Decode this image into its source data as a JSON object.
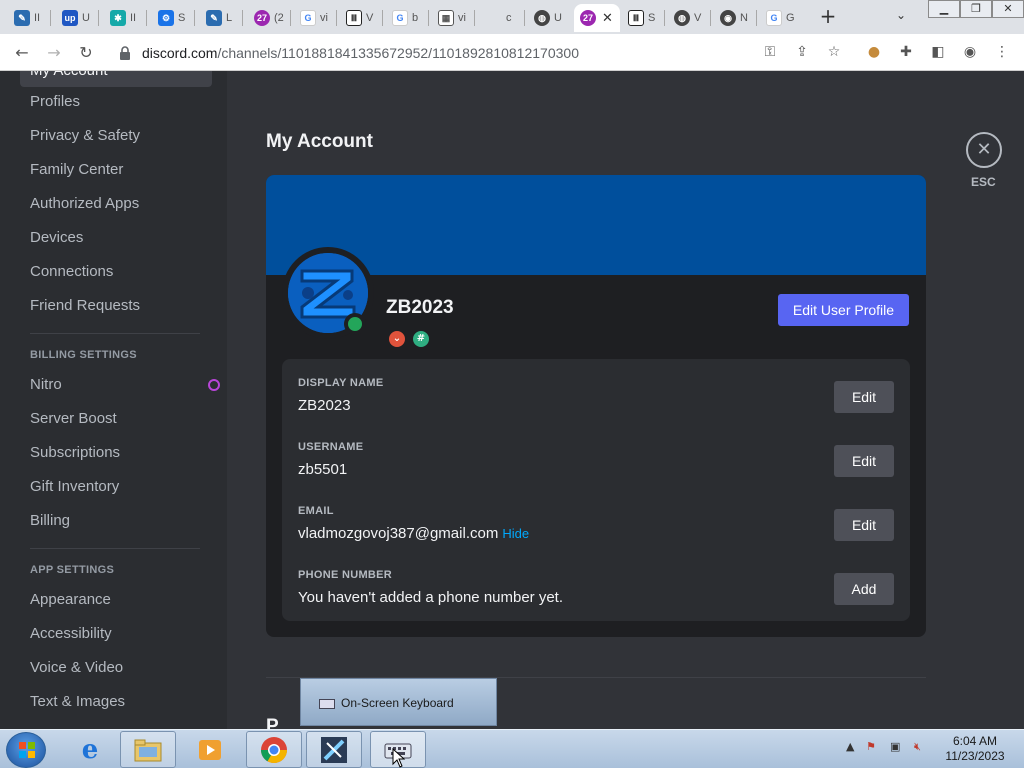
{
  "browser": {
    "tabs": [
      {
        "title": "II",
        "icon": "feather-icon",
        "color": "#2b6cb0"
      },
      {
        "title": "U",
        "icon": "upwork-icon",
        "color": "#1f57c3"
      },
      {
        "title": "II",
        "icon": "snowflake-icon",
        "color": "#15a9a9"
      },
      {
        "title": "S",
        "icon": "gear-icon",
        "color": "#1a73e8"
      },
      {
        "title": "L",
        "icon": "feather-icon",
        "color": "#2b6cb0"
      },
      {
        "title": "(2",
        "icon": "counter-badge-icon",
        "color": "#9c27b0"
      },
      {
        "title": "vi",
        "icon": "google-icon",
        "color": "#4285f4"
      },
      {
        "title": "V",
        "icon": "museum-icon",
        "color": "#222222"
      },
      {
        "title": "b",
        "icon": "google-icon",
        "color": "#4285f4"
      },
      {
        "title": "vi",
        "icon": "qr-icon",
        "color": "#555555"
      },
      {
        "title": "c",
        "icon": "blank-icon",
        "color": "#cccccc"
      },
      {
        "title": "U",
        "icon": "globe-icon",
        "color": "#444444"
      },
      {
        "title": "",
        "icon": "counter-badge-icon",
        "color": "#9c27b0",
        "active": true
      },
      {
        "title": "S",
        "icon": "museum-icon",
        "color": "#222222"
      },
      {
        "title": "V",
        "icon": "globe-icon",
        "color": "#444444"
      },
      {
        "title": "N",
        "icon": "chrome-icon",
        "color": "#444444"
      },
      {
        "title": "G",
        "icon": "google-icon",
        "color": "#4285f4"
      }
    ],
    "url_host": "discord.com",
    "url_path": "/channels/1101881841335672952/1101892810812170300"
  },
  "sidebar": {
    "top_partial": "My Account",
    "user_items": [
      "Profiles",
      "Privacy & Safety",
      "Family Center",
      "Authorized Apps",
      "Devices",
      "Connections",
      "Friend Requests"
    ],
    "billing_header": "BILLING SETTINGS",
    "billing_items": [
      "Nitro",
      "Server Boost",
      "Subscriptions",
      "Gift Inventory",
      "Billing"
    ],
    "app_header": "APP SETTINGS",
    "app_items": [
      "Appearance",
      "Accessibility",
      "Voice & Video",
      "Text & Images"
    ]
  },
  "main": {
    "title": "My Account",
    "esc_label": "ESC",
    "banner_color": "#004f9c",
    "profile": {
      "username": "ZB2023",
      "edit_profile_label": "Edit User Profile",
      "badges": [
        "hypesquad-icon",
        "hashtag-icon"
      ]
    },
    "fields": [
      {
        "label": "DISPLAY NAME",
        "value": "ZB2023",
        "action": "Edit"
      },
      {
        "label": "USERNAME",
        "value": "zb5501",
        "action": "Edit"
      },
      {
        "label": "EMAIL",
        "value": "vladmozgovoj387@gmail.com",
        "extra": "Hide",
        "action": "Edit"
      },
      {
        "label": "PHONE NUMBER",
        "value": "You haven't added a phone number yet.",
        "action": "Add"
      }
    ],
    "next_section_partial": "P"
  },
  "taskbar": {
    "osk_label": "On-Screen Keyboard",
    "time": "6:04 AM",
    "date": "11/23/2023"
  },
  "colors": {
    "accent": "#5865f2",
    "status_online": "#23a55a",
    "link": "#00a8fc"
  }
}
